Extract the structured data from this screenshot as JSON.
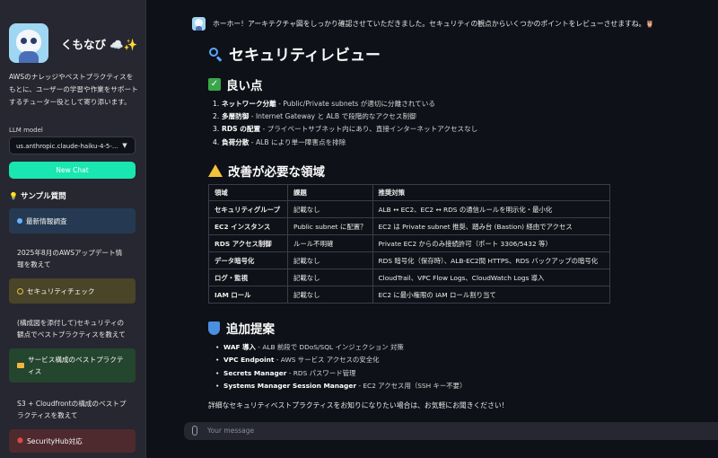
{
  "sidebar": {
    "brand_name": "くもなび ☁️✨",
    "intro": "AWSのナレッジやベストプラクティスをもとに、ユーザーの学習や作業をサポートするチューター役として寄り添います。",
    "llm_label": "LLM model",
    "llm_value": "us.anthropic.claude-haiku-4-5-...",
    "new_chat": "New Chat",
    "sample_title": "サンプル質問",
    "items": [
      {
        "label": "最新情報調査",
        "style": "card",
        "bg": "#253a52",
        "icon": "blue-dot-icon"
      },
      {
        "label": "2025年8月のAWSアップデート情報を教えて",
        "style": "plain"
      },
      {
        "label": "セキュリティチェック",
        "style": "card",
        "bg": "#4a4428",
        "icon": "yellow-circle-icon"
      },
      {
        "label": "(構成図を添付して)セキュリティの観点でベストプラクティスを教えて",
        "style": "plain"
      },
      {
        "label": "サービス構成のベストプラクティス",
        "style": "card",
        "bg": "#24452e",
        "icon": "folder-icon"
      },
      {
        "label": "S3 + Cloudfrontの構成のベストプラクティスを教えて",
        "style": "plain"
      },
      {
        "label": "SecurityHub対応",
        "style": "card",
        "bg": "#4e2a2e",
        "icon": "hexagon-icon"
      }
    ]
  },
  "main": {
    "greeting": "ホーホー！アーキテクチャ図をしっかり確認させていただきました。セキュリティの観点からいくつかのポイントをレビューさせますね。🦉",
    "title": "セキュリティレビュー",
    "good_heading": "良い点",
    "good_points": [
      {
        "bold": "ネットワーク分離",
        "rest": " - Public/Private subnets が適切に分離されている"
      },
      {
        "bold": "多層防御",
        "rest": " - Internet Gateway と ALB で段階的なアクセス制御"
      },
      {
        "bold": "RDS の配置",
        "rest": " - プライベートサブネット内にあり、直接インターネットアクセスなし"
      },
      {
        "bold": "負荷分散",
        "rest": " - ALB により単一障害点を排除"
      }
    ],
    "improve_heading": "改善が必要な領域",
    "table": {
      "headers": [
        "領域",
        "課題",
        "推奨対策"
      ],
      "rows": [
        [
          "セキュリティグループ",
          "記載なし",
          "ALB ↔ EC2、EC2 ↔ RDS の通信ルールを明示化・最小化"
        ],
        [
          "EC2 インスタンス",
          "Public subnet に配置？",
          "EC2 は Private subnet 推奨、踏み台 (Bastion) 経由でアクセス"
        ],
        [
          "RDS アクセス制御",
          "ルール不明確",
          "Private EC2 からのみ接続許可（ポート 3306/5432 等）"
        ],
        [
          "データ暗号化",
          "記載なし",
          "RDS 暗号化（保存時）、ALB-EC2間 HTTPS、RDS バックアップの暗号化"
        ],
        [
          "ログ・監視",
          "記載なし",
          "CloudTrail、VPC Flow Logs、CloudWatch Logs 導入"
        ],
        [
          "IAM ロール",
          "記載なし",
          "EC2 に最小権限の IAM ロール割り当て"
        ]
      ]
    },
    "extra_heading": "追加提案",
    "extra_points": [
      {
        "bold": "WAF 導入",
        "rest": " - ALB 前段で DDoS/SQL インジェクション 対策"
      },
      {
        "bold": "VPC Endpoint",
        "rest": " - AWS サービス アクセスの安全化"
      },
      {
        "bold": "Secrets Manager",
        "rest": " - RDS パスワード管理"
      },
      {
        "bold": "Systems Manager Session Manager",
        "rest": " - EC2 アクセス用（SSH キー不要）"
      }
    ],
    "footer": "詳細なセキュリティベストプラクティスをお知りになりたい場合は、お気軽にお聞きください！",
    "input_placeholder": "Your message"
  }
}
